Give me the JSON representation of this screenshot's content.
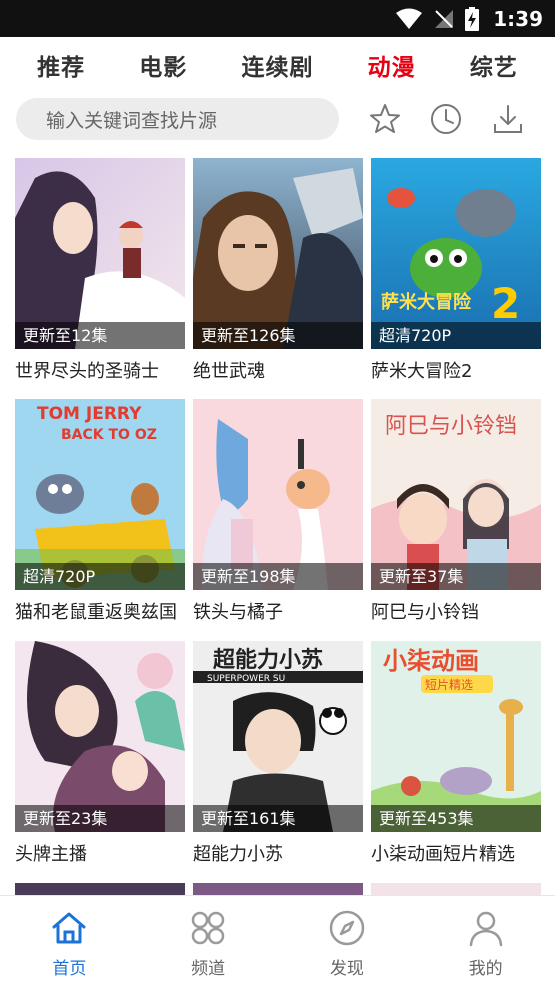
{
  "status_bar": {
    "time": "1:39"
  },
  "tabs": [
    {
      "label": "推荐",
      "active": false
    },
    {
      "label": "电影",
      "active": false
    },
    {
      "label": "连续剧",
      "active": false
    },
    {
      "label": "动漫",
      "active": true
    },
    {
      "label": "综艺",
      "active": false
    }
  ],
  "search": {
    "placeholder": "输入关键词查找片源"
  },
  "toolbar_icons": [
    "star-icon",
    "history-clock-icon",
    "download-icon"
  ],
  "colors": {
    "active_tab": "#e60012",
    "active_nav": "#1a73d9",
    "inactive_nav": "#9a9a9a",
    "search_bg": "#ececec"
  },
  "items": [
    {
      "title": "世界尽头的圣骑士",
      "badge": "更新至12集"
    },
    {
      "title": "绝世武魂",
      "badge": "更新至126集"
    },
    {
      "title": "萨米大冒险2",
      "badge": "超清720P"
    },
    {
      "title": "猫和老鼠重返奥兹国",
      "badge": "超清720P"
    },
    {
      "title": "铁头与橘子",
      "badge": "更新至198集"
    },
    {
      "title": "阿巳与小铃铛",
      "badge": "更新至37集"
    },
    {
      "title": "头牌主播",
      "badge": "更新至23集"
    },
    {
      "title": "超能力小苏",
      "badge": "更新至161集"
    },
    {
      "title": "小柒动画短片精选",
      "badge": "更新至453集"
    }
  ],
  "bottom_nav": [
    {
      "label": "首页",
      "icon": "home-icon",
      "active": true
    },
    {
      "label": "频道",
      "icon": "channels-grid-icon",
      "active": false
    },
    {
      "label": "发现",
      "icon": "compass-icon",
      "active": false
    },
    {
      "label": "我的",
      "icon": "profile-icon",
      "active": false
    }
  ]
}
